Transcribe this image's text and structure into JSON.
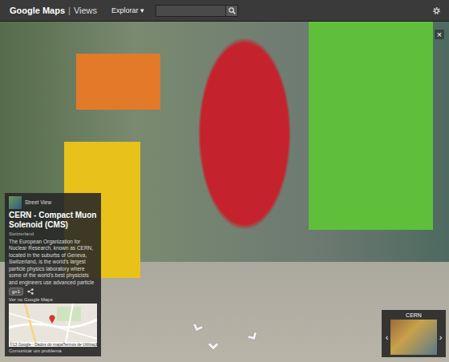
{
  "header": {
    "brand": "Google Maps",
    "separator": "|",
    "section": "Views",
    "menu": "Explorar ▾",
    "search": {
      "placeholder": ""
    }
  },
  "viewer": {
    "close": "×"
  },
  "panel": {
    "badge": "Street View",
    "title": "CERN - Compact Muon Solenoid (CMS)",
    "country": "Switzerland",
    "description": "The European Organization for Nuclear Research, known as CERN, located in the suburbs of Geneva, Switzerland, is the world's largest particle physics laboratory where some of the world's best physicists and engineers use advanced particle",
    "plus_button": "g+1",
    "link": "Ver no Google Maps",
    "map_attribution": [
      "©13 Google - Dados do mapa",
      "Termos de Utilização"
    ],
    "report": "Comunicar um problema"
  },
  "thumbnail": {
    "label": "CERN",
    "prev": "‹",
    "next": "›"
  }
}
